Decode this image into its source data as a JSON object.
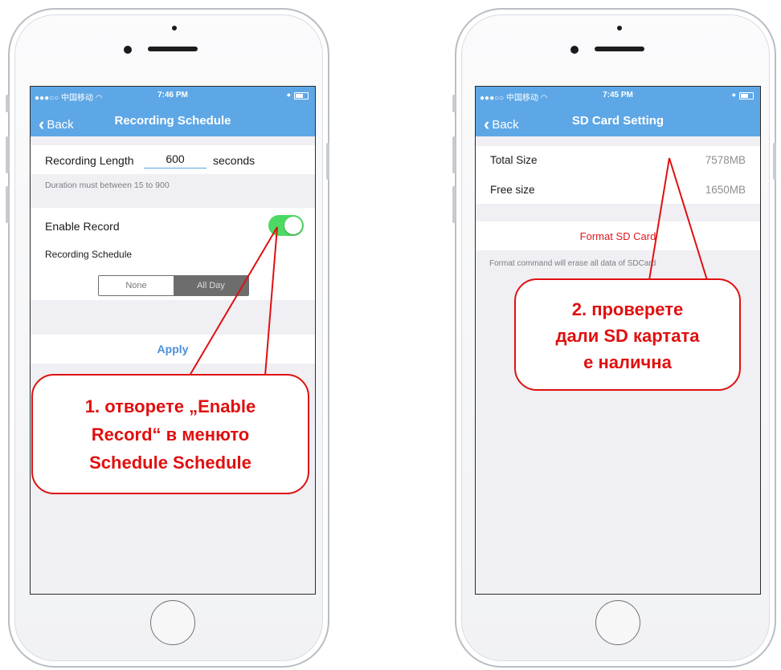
{
  "left_phone": {
    "status": {
      "carrier": "●●●○○ 中国移动 ◠",
      "time": "7:46 PM"
    },
    "nav": {
      "back_label": "Back",
      "title": "Recording Schedule"
    },
    "recording_length": {
      "label": "Recording Length",
      "value": "600",
      "unit": "seconds"
    },
    "duration_hint": "Duration must between 15 to 900",
    "enable_record": {
      "label": "Enable Record",
      "on": true
    },
    "schedule_label": "Recording Schedule",
    "segment": {
      "options": [
        "None",
        "All Day"
      ],
      "selected": "All Day"
    },
    "apply_label": "Apply"
  },
  "right_phone": {
    "status": {
      "carrier": "●●●○○ 中国移动 ◠",
      "time": "7:45 PM"
    },
    "nav": {
      "back_label": "Back",
      "title": "SD Card Setting"
    },
    "total_size": {
      "label": "Total Size",
      "value": "7578MB"
    },
    "free_size": {
      "label": "Free size",
      "value": "1650MB"
    },
    "format_label": "Format SD Card",
    "format_hint": "Format command will erase all data of SDCard"
  },
  "callouts": {
    "left": [
      "1. отворете „Enable",
      "Record“ в менюто",
      "Schedule Schedule"
    ],
    "right": [
      "2. проверете",
      "дали SD картата",
      "е налична"
    ]
  },
  "colors": {
    "nav_blue": "#5ea7e6",
    "toggle_green": "#4cd964",
    "callout_red": "#e01010",
    "format_red": "#e0181d",
    "apply_blue": "#4a90d9"
  }
}
